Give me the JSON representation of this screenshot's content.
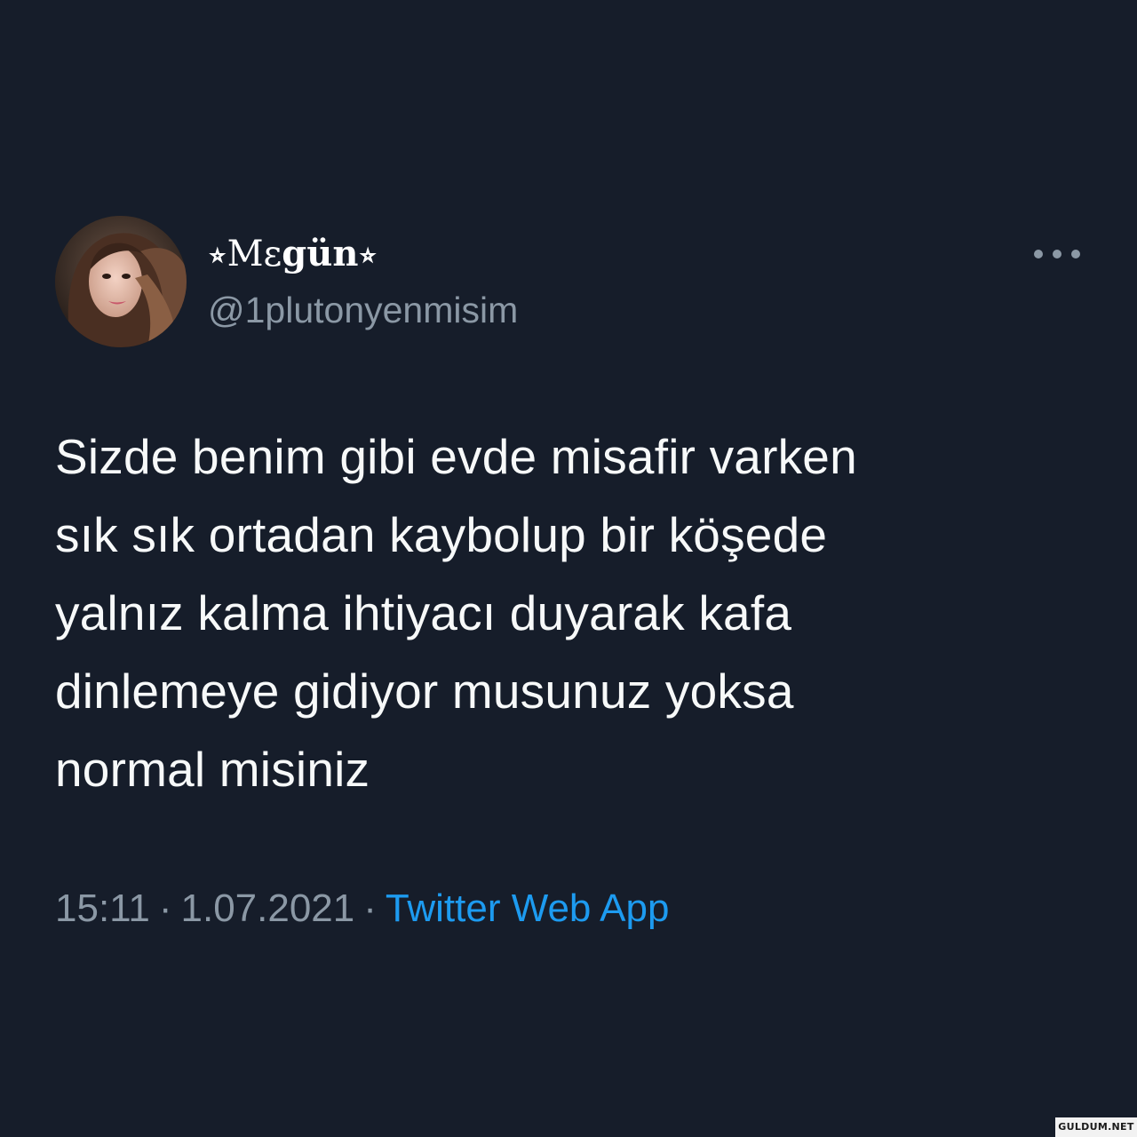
{
  "tweet": {
    "author": {
      "display_name_prefix": "⭒Mɛ",
      "display_name_bold": "gün",
      "display_name_suffix": "⭒",
      "handle": "@1plutonyenmisim"
    },
    "text_lines": [
      "Sizde benim gibi evde misafir varken",
      "sık sık ortadan kaybolup bir köşede",
      "yalnız kalma ihtiyacı duyarak kafa",
      "dinlemeye gidiyor musunuz yoksa",
      "normal misiniz"
    ],
    "time": "15:11",
    "date": "1.07.2021",
    "separator": "·",
    "source": "Twitter Web App"
  },
  "watermark": "GULDUM.NET",
  "colors": {
    "background": "#161d2a",
    "text": "#f7f9f9",
    "muted": "#8b98a5",
    "link": "#1d9bf0"
  },
  "icons": {
    "more": "more-horizontal-icon",
    "avatar": "profile-photo"
  }
}
